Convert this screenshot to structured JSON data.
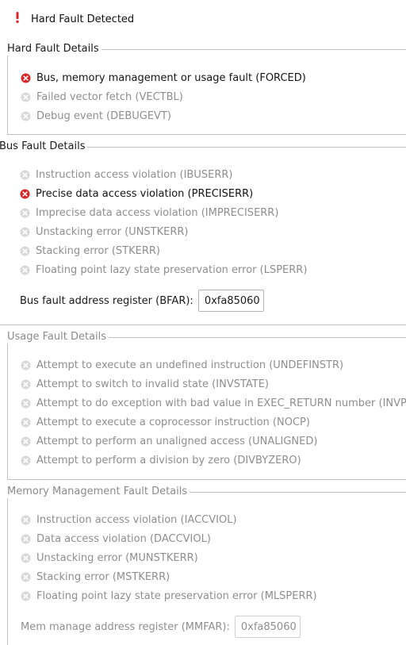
{
  "alert": {
    "icon": "exclamation-icon",
    "title": "Hard Fault Detected"
  },
  "colors": {
    "error": "#d92626",
    "disabled": "#d9d9d9",
    "border": "#c3c3c3"
  },
  "hard_fault": {
    "title": "Hard Fault Details",
    "items": [
      {
        "label": "Bus, memory management or usage fault (FORCED)",
        "active": true
      },
      {
        "label": "Failed vector fetch (VECTBL)",
        "active": false
      },
      {
        "label": "Debug event (DEBUGEVT)",
        "active": false
      }
    ]
  },
  "bus_fault": {
    "title": "Bus Fault Details",
    "items": [
      {
        "label": "Instruction access violation (IBUSERR)",
        "active": false
      },
      {
        "label": "Precise data access violation (PRECISERR)",
        "active": true
      },
      {
        "label": "Imprecise data access violation (IMPRECISERR)",
        "active": false
      },
      {
        "label": "Unstacking error (UNSTKERR)",
        "active": false
      },
      {
        "label": "Stacking error (STKERR)",
        "active": false
      },
      {
        "label": "Floating point lazy state preservation error (LSPERR)",
        "active": false
      }
    ],
    "address_label": "Bus fault address register (BFAR):",
    "address_value": "0xfa85060"
  },
  "usage_fault": {
    "title": "Usage Fault Details",
    "items": [
      {
        "label": "Attempt to execute an undefined instruction (UNDEFINSTR)",
        "active": false
      },
      {
        "label": "Attempt to switch to invalid state (INVSTATE)",
        "active": false
      },
      {
        "label": "Attempt to do exception with bad value in EXEC_RETURN number (INVPC)",
        "active": false
      },
      {
        "label": "Attempt to execute a coprocessor instruction (NOCP)",
        "active": false
      },
      {
        "label": "Attempt to perform an unaligned access (UNALIGNED)",
        "active": false
      },
      {
        "label": "Attempt to perform a division by zero (DIVBYZERO)",
        "active": false
      }
    ]
  },
  "mem_fault": {
    "title": "Memory Management Fault Details",
    "items": [
      {
        "label": "Instruction access violation (IACCVIOL)",
        "active": false
      },
      {
        "label": "Data access violation (DACCVIOL)",
        "active": false
      },
      {
        "label": "Unstacking error (MUNSTKERR)",
        "active": false
      },
      {
        "label": "Stacking error (MSTKERR)",
        "active": false
      },
      {
        "label": "Floating point lazy state preservation error (MLSPERR)",
        "active": false
      }
    ],
    "address_label": "Mem manage address register (MMFAR):",
    "address_value": "0xfa85060"
  }
}
